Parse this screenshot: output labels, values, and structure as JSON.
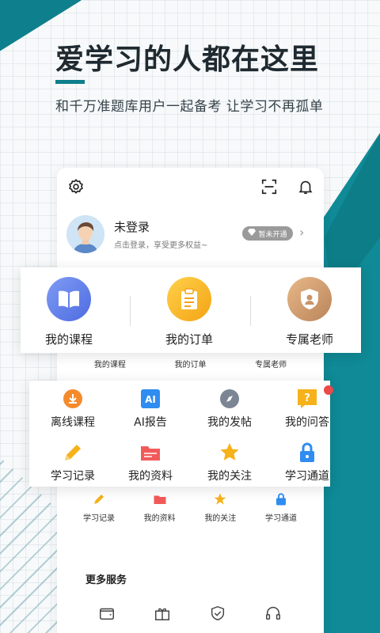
{
  "headline": "爱学习的人都在这里",
  "tagline": "和千万准题库用户一起备考 让学习不再孤单",
  "colors": {
    "teal": "#0f8a96",
    "accent_orange": "#f6b21a",
    "blue": "#5b7be6",
    "red": "#ea4a4a"
  },
  "profile": {
    "title": "未登录",
    "subtitle": "点击登录，享受更多权益~",
    "vip_badge": "暂未开通"
  },
  "big_menu": [
    {
      "label": "我的课程",
      "icon": "book-icon"
    },
    {
      "label": "我的订单",
      "icon": "clipboard-icon"
    },
    {
      "label": "专属老师",
      "icon": "teacher-shield-icon"
    }
  ],
  "small_row1": [
    "我的课程",
    "我的订单",
    "专属老师"
  ],
  "grid": [
    {
      "label": "离线课程",
      "icon": "download-icon"
    },
    {
      "label": "AI报告",
      "icon": "ai-icon"
    },
    {
      "label": "我的发帖",
      "icon": "compass-icon"
    },
    {
      "label": "我的问答",
      "icon": "question-icon"
    },
    {
      "label": "学习记录",
      "icon": "pencil-icon"
    },
    {
      "label": "我的资料",
      "icon": "folder-icon"
    },
    {
      "label": "我的关注",
      "icon": "star-icon"
    },
    {
      "label": "学习通道",
      "icon": "lock-icon"
    }
  ],
  "small_row2": [
    "学习记录",
    "我的资料",
    "我的关注",
    "学习通道"
  ],
  "more_services": {
    "title": "更多服务",
    "icons": [
      "wallet-icon",
      "gift-icon",
      "shield-check-icon",
      "headset-icon"
    ]
  }
}
